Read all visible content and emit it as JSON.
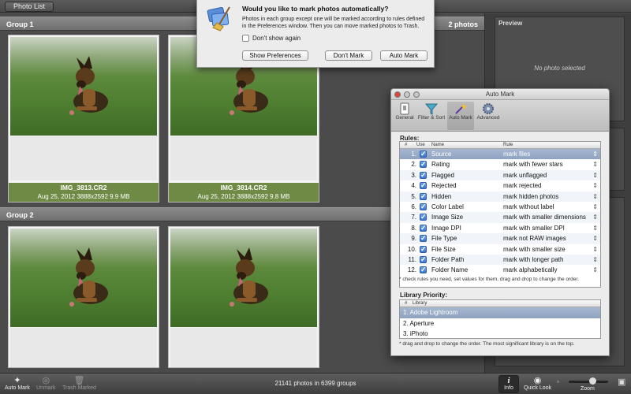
{
  "topbar": {
    "photo_list_label": "Photo List"
  },
  "groups": [
    {
      "title": "Group 1",
      "count": "2 photos",
      "photos": [
        {
          "name": "IMG_3813.CR2",
          "meta": "Aug 25, 2012   3888x2592   9.9 MB"
        },
        {
          "name": "IMG_3814.CR2",
          "meta": "Aug 25, 2012   3888x2592   9.8 MB"
        }
      ]
    },
    {
      "title": "Group 2",
      "count": "",
      "photos": [
        {
          "name": "",
          "meta": ""
        },
        {
          "name": "",
          "meta": ""
        }
      ]
    }
  ],
  "preview": {
    "title": "Preview",
    "empty_text": "No photo selected"
  },
  "alert": {
    "title": "Would you like to mark photos automatically?",
    "body": "Photos in each group except one will be marked according to rules defined in the Preferences window. Then you can move marked photos to Trash.",
    "checkbox_label": "Don't show again",
    "btn_show_prefs": "Show Preferences",
    "btn_dont_mark": "Don't Mark",
    "btn_auto_mark": "Auto Mark"
  },
  "automark": {
    "window_title": "Auto Mark",
    "toolbar": [
      {
        "label": "General",
        "icon": "general-icon"
      },
      {
        "label": "Filter & Sort",
        "icon": "filter-icon"
      },
      {
        "label": "Auto Mark",
        "icon": "wand-icon"
      },
      {
        "label": "Advanced",
        "icon": "gear-icon"
      }
    ],
    "rules_label": "Rules:",
    "columns": {
      "num": "#",
      "use": "Use",
      "name": "Name",
      "rule": "Rule"
    },
    "rules": [
      {
        "num": "1.",
        "name": "Source",
        "rule": "mark files"
      },
      {
        "num": "2.",
        "name": "Rating",
        "rule": "mark with fewer stars"
      },
      {
        "num": "3.",
        "name": "Flagged",
        "rule": "mark unflagged"
      },
      {
        "num": "4.",
        "name": "Rejected",
        "rule": "mark rejected"
      },
      {
        "num": "5.",
        "name": "Hidden",
        "rule": "mark hidden photos"
      },
      {
        "num": "6.",
        "name": "Color Label",
        "rule": "mark without label"
      },
      {
        "num": "7.",
        "name": "Image Size",
        "rule": "mark with smaller dimensions"
      },
      {
        "num": "8.",
        "name": "Image DPI",
        "rule": "mark with smaller DPI"
      },
      {
        "num": "9.",
        "name": "File Type",
        "rule": "mark not RAW images"
      },
      {
        "num": "10.",
        "name": "File Size",
        "rule": "mark with smaller size"
      },
      {
        "num": "11.",
        "name": "Folder Path",
        "rule": "mark with longer path"
      },
      {
        "num": "12.",
        "name": "Folder Name",
        "rule": "mark alphabetically"
      }
    ],
    "rules_note": "* check rules you need, set values for them, drag and drop to change the order.",
    "library_label": "Library Priority:",
    "library_columns": {
      "num": "#",
      "name": "Library"
    },
    "libraries": [
      {
        "num": "1.",
        "name": "Adobe Lightroom"
      },
      {
        "num": "2.",
        "name": "Aperture"
      },
      {
        "num": "3.",
        "name": "iPhoto"
      }
    ],
    "library_note": "* drag and drop to change the order. The most significant library is on the top."
  },
  "bottombar": {
    "auto_mark": "Auto Mark",
    "unmark": "Unmark",
    "trash_marked": "Trash Marked",
    "status": "21141 photos in 6399 groups",
    "info": "Info",
    "quick_look": "Quick Look",
    "zoom": "Zoom",
    "zoom_level": 0.6
  },
  "colors": {
    "caption_green": "#6f8a45",
    "selection_blue": "#8ea2c0"
  }
}
